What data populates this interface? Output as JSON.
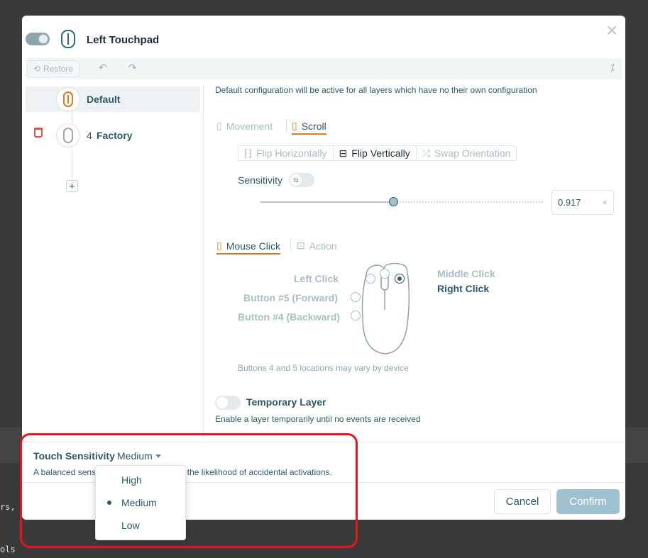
{
  "background": {
    "line1": "rs,",
    "line2": "ols"
  },
  "header": {
    "title": "Left Touchpad",
    "close_icon": "close-icon"
  },
  "toolbar": {
    "restore_label": "Restore",
    "undo": "↶",
    "redo": "↷",
    "reset": "⁄"
  },
  "layers": [
    {
      "index": "",
      "label": "Default",
      "selected": true
    },
    {
      "index": "4",
      "label": "Factory",
      "selected": false
    }
  ],
  "config": {
    "description": "Default configuration will be active for all layers which have no their own configuration",
    "tabs": {
      "movement": "Movement",
      "scroll": "Scroll"
    },
    "segments": [
      "Flip Horizontally",
      "Flip Vertically",
      "Swap Orientation"
    ],
    "sensitivity_label": "Sensitivity",
    "sensitivity_value": "0.917",
    "sensitivity_fraction": 0.47,
    "click_tabs": {
      "mouse_click": "Mouse Click",
      "action": "Action"
    },
    "buttons": {
      "left_click": "Left Click",
      "button5": "Button #5 (Forward)",
      "button4": "Button #4 (Backward)",
      "middle_click": "Middle Click",
      "right_click": "Right Click"
    },
    "buttons_note": "Buttons 4 and 5 locations may vary by device",
    "temp_layer_label": "Temporary Layer",
    "temp_layer_desc": "Enable a layer temporarily until no events are received"
  },
  "touch_sensitivity": {
    "label": "Touch Sensitivity",
    "value": "Medium",
    "desc_left": "A balanced sensi",
    "desc_right": "es the likelihood of accidental activations.",
    "options": [
      "High",
      "Medium",
      "Low"
    ],
    "selected": "Medium"
  },
  "footer": {
    "cancel": "Cancel",
    "confirm": "Confirm"
  }
}
